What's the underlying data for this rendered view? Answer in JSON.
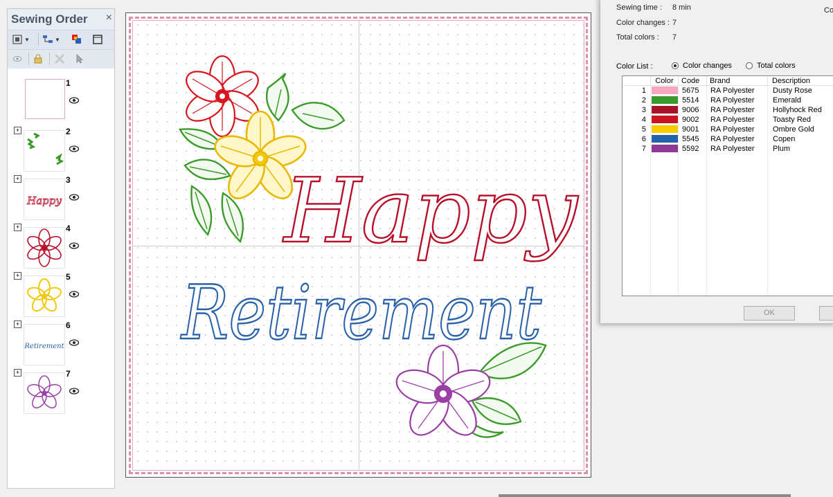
{
  "panel": {
    "title": "Sewing Order",
    "layers": [
      {
        "number": "1",
        "name": "dusty-rose-frame"
      },
      {
        "number": "2",
        "name": "leaves"
      },
      {
        "number": "3",
        "name": "happy",
        "thumb_text": "Happy"
      },
      {
        "number": "4",
        "name": "red-flower"
      },
      {
        "number": "5",
        "name": "yellow-flower"
      },
      {
        "number": "6",
        "name": "retirement",
        "thumb_text": "Retirement"
      },
      {
        "number": "7",
        "name": "purple-flower"
      }
    ],
    "icons": [
      "fit-icon",
      "group-icon",
      "color-order-icon",
      "frame-icon",
      "eye-icon",
      "lock-icon",
      "delete-icon",
      "pointer-icon"
    ]
  },
  "design": {
    "line1": "Happy",
    "line2": "Retirement",
    "colors": {
      "frame": "#e39ab1",
      "leaf": "#3a9a2a",
      "red_flower": "#d8141e",
      "yellow_flower": "#f2c80a",
      "happy": "#b8102a",
      "retirement": "#2a62aa",
      "purple_flower": "#9b3fa6"
    }
  },
  "dialog": {
    "sewing_time_label": "Sewing time :",
    "sewing_time": "8 min",
    "color_changes_label": "Color changes :",
    "color_changes": "7",
    "total_colors_label": "Total colors :",
    "total_colors": "7",
    "corner_text": "Co",
    "color_list_label": "Color List :",
    "radio_color_changes": "Color changes",
    "radio_total_colors": "Total colors",
    "radio_selected": "Color changes",
    "columns": [
      "Color",
      "Code",
      "Brand",
      "Description"
    ],
    "rows": [
      {
        "n": "1",
        "color": "#f6a6bd",
        "code": "5675",
        "brand": "RA Polyester",
        "desc": "Dusty Rose"
      },
      {
        "n": "2",
        "color": "#3b9a2d",
        "code": "5514",
        "brand": "RA Polyester",
        "desc": "Emerald"
      },
      {
        "n": "3",
        "color": "#a81226",
        "code": "9006",
        "brand": "RA Polyester",
        "desc": "Hollyhock Red"
      },
      {
        "n": "4",
        "color": "#c91423",
        "code": "9002",
        "brand": "RA Polyester",
        "desc": "Toasty Red"
      },
      {
        "n": "5",
        "color": "#f5cc00",
        "code": "9001",
        "brand": "RA Polyester",
        "desc": "Ombre Gold"
      },
      {
        "n": "6",
        "color": "#2462ad",
        "code": "5545",
        "brand": "RA Polyester",
        "desc": "Copen"
      },
      {
        "n": "7",
        "color": "#8e3a95",
        "code": "5592",
        "brand": "RA Polyester",
        "desc": "Plum"
      }
    ],
    "ok_label": "OK"
  }
}
